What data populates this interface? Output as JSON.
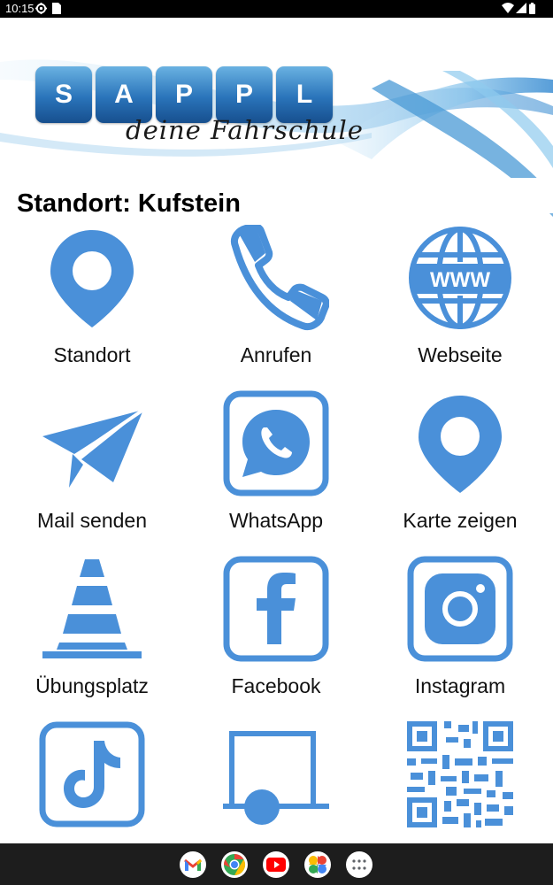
{
  "status_bar": {
    "time": "10:15",
    "left_icons": [
      "settings-gear-icon",
      "sim-card-icon"
    ],
    "right_icons": [
      "wifi-icon",
      "signal-icon",
      "battery-icon"
    ]
  },
  "header": {
    "logo_letters": [
      "S",
      "A",
      "P",
      "P",
      "L"
    ],
    "tagline": "deine Fahrschule"
  },
  "page": {
    "title": "Standort: Kufstein"
  },
  "accent_color": "#4a90d9",
  "tiles": [
    {
      "label": "Standort",
      "icon": "location-pin-icon"
    },
    {
      "label": "Anrufen",
      "icon": "phone-icon"
    },
    {
      "label": "Webseite",
      "icon": "globe-www-icon"
    },
    {
      "label": "Mail senden",
      "icon": "paper-plane-icon"
    },
    {
      "label": "WhatsApp",
      "icon": "whatsapp-icon"
    },
    {
      "label": "Karte zeigen",
      "icon": "map-pin-icon"
    },
    {
      "label": "Übungsplatz",
      "icon": "traffic-cone-icon"
    },
    {
      "label": "Facebook",
      "icon": "facebook-icon"
    },
    {
      "label": "Instagram",
      "icon": "instagram-icon"
    },
    {
      "label": "",
      "icon": "tiktok-icon"
    },
    {
      "label": "",
      "icon": "trailer-icon"
    },
    {
      "label": "",
      "icon": "qr-code-icon"
    }
  ],
  "nav_bar": {
    "apps": [
      "gmail-icon",
      "chrome-icon",
      "youtube-icon",
      "photos-icon",
      "app-drawer-icon"
    ]
  }
}
